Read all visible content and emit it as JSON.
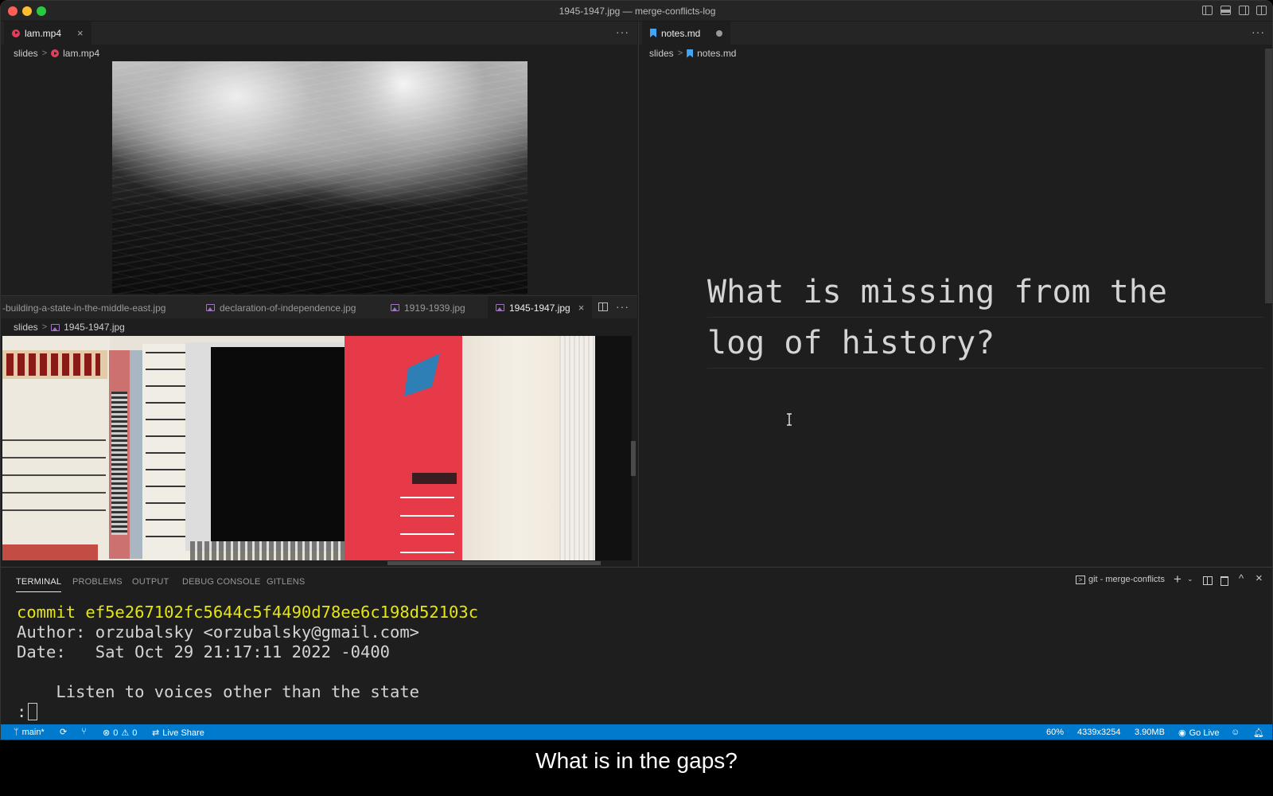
{
  "window": {
    "title": "1945-1947.jpg — merge-conflicts-log"
  },
  "top_left_group": {
    "tab": {
      "label": "lam.mp4",
      "icon": "video-file-icon"
    },
    "breadcrumb": {
      "folder": "slides",
      "file": "lam.mp4"
    },
    "more_actions": "···"
  },
  "bottom_left_group": {
    "tabs": [
      {
        "label": "-building-a-state-in-the-middle-east.jpg",
        "active": false
      },
      {
        "label": "declaration-of-independence.jpg",
        "active": false
      },
      {
        "label": "1919-1939.jpg",
        "active": false
      },
      {
        "label": "1945-1947.jpg",
        "active": true
      }
    ],
    "breadcrumb": {
      "folder": "slides",
      "file": "1945-1947.jpg"
    },
    "more_actions": "···"
  },
  "right_group": {
    "tab": {
      "label": "notes.md",
      "dirty": true
    },
    "breadcrumb": {
      "folder": "slides",
      "file": "notes.md"
    },
    "more_actions": "···",
    "heading_lines": [
      "What is missing from the",
      "log of history?"
    ]
  },
  "panel": {
    "tabs": [
      "TERMINAL",
      "PROBLEMS",
      "OUTPUT",
      "DEBUG CONSOLE",
      "GITLENS"
    ],
    "active_tab": "TERMINAL",
    "terminal_name": "git - merge-conflicts",
    "terminal_lines": {
      "commit": "commit ef5e267102fc5644c5f4490d78ee6c198d52103c",
      "author": "Author: orzubalsky <orzubalsky@gmail.com>",
      "date": "Date:   Sat Oct 29 21:17:11 2022 -0400",
      "message": "    Listen to voices other than the state",
      "prompt": ":"
    }
  },
  "statusbar": {
    "branch": "main*",
    "errors": "0",
    "warnings": "0",
    "live_share": "Live Share",
    "zoom": "60%",
    "dimensions": "4339x3254",
    "filesize": "3.90MB",
    "go_live": "Go Live",
    "color": "#007acc"
  },
  "subtitle": "What is in the gaps?"
}
